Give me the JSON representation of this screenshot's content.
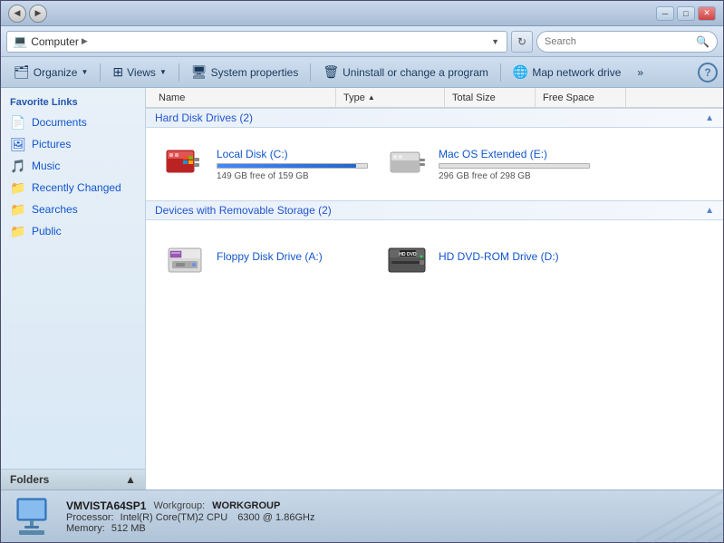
{
  "window": {
    "title": "Computer"
  },
  "titlebar": {
    "back_label": "◀",
    "forward_label": "▶"
  },
  "addressbar": {
    "icon": "💻",
    "path_root": "Computer",
    "arrow": "▶",
    "path_label": "Computer",
    "refresh_label": "↻",
    "search_placeholder": "Search"
  },
  "toolbar": {
    "organize_label": "Organize",
    "views_label": "Views",
    "sysprops_label": "System properties",
    "uninstall_label": "Uninstall or change a program",
    "mapnetwork_label": "Map network drive",
    "more_label": "»",
    "help_label": "?"
  },
  "sidebar": {
    "section_label": "Favorite Links",
    "links": [
      {
        "id": "documents",
        "label": "Documents",
        "icon": "📄"
      },
      {
        "id": "pictures",
        "label": "Pictures",
        "icon": "🖼"
      },
      {
        "id": "music",
        "label": "Music",
        "icon": "♫"
      },
      {
        "id": "recently-changed",
        "label": "Recently Changed",
        "icon": "📁"
      },
      {
        "id": "searches",
        "label": "Searches",
        "icon": "📁"
      },
      {
        "id": "public",
        "label": "Public",
        "icon": "📁"
      }
    ],
    "folders_label": "Folders",
    "folders_arrow": "▲"
  },
  "columns": {
    "name": "Name",
    "type": "Type",
    "type_sort_arrow": "▲",
    "total_size": "Total Size",
    "free_space": "Free Space"
  },
  "sections": {
    "hard_disks": {
      "label": "Hard Disk Drives (2)",
      "collapse_icon": "▲"
    },
    "removable": {
      "label": "Devices with Removable Storage (2)",
      "collapse_icon": "▲"
    }
  },
  "drives": {
    "hard_disks": [
      {
        "id": "local-c",
        "name": "Local Disk (C:)",
        "bar_pct": 93,
        "bar_color": "blue",
        "free_text": "149 GB free of 159 GB",
        "icon_type": "hdd"
      },
      {
        "id": "mac-e",
        "name": "Mac OS Extended (E:)",
        "bar_pct": 0,
        "bar_color": "gray",
        "free_text": "296 GB free of 298 GB",
        "icon_type": "mac"
      }
    ],
    "removable": [
      {
        "id": "floppy-a",
        "name": "Floppy Disk Drive (A:)",
        "icon_type": "floppy"
      },
      {
        "id": "hddvd-d",
        "name": "HD DVD-ROM Drive (D:)",
        "icon_type": "hddvd"
      }
    ]
  },
  "statusbar": {
    "hostname": "VMVISTA64SP1",
    "workgroup_label": "Workgroup:",
    "workgroup": "WORKGROUP",
    "processor_label": "Processor:",
    "processor": "Intel(R) Core(TM)2 CPU",
    "processor_speed": "6300  @ 1.86GHz",
    "memory_label": "Memory:",
    "memory": "512 MB"
  }
}
